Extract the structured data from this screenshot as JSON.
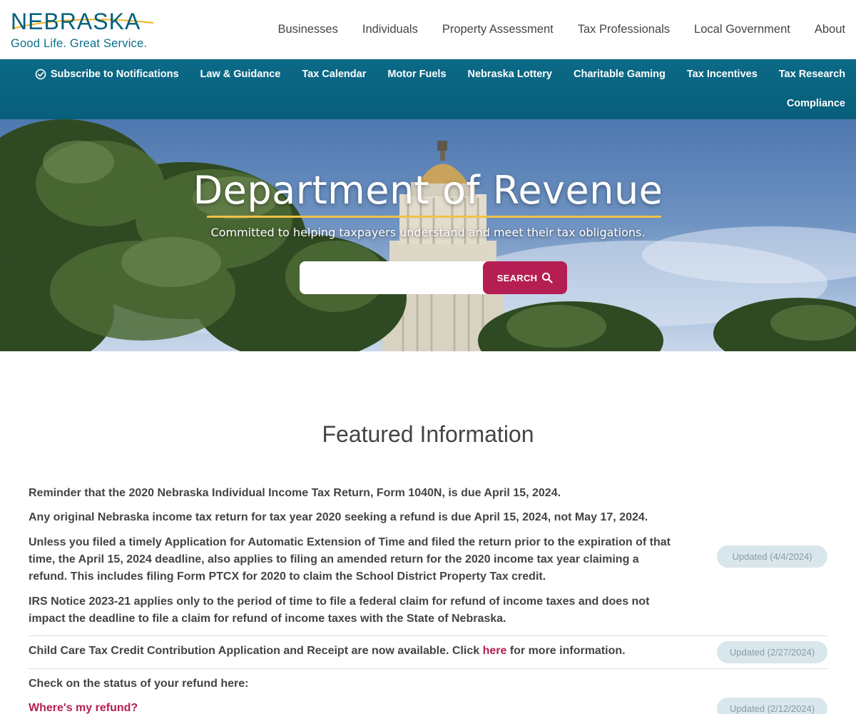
{
  "logo": {
    "wordmark": "NEBRASKA",
    "tagline": "Good Life. Great Service."
  },
  "main_nav": [
    {
      "label": "Businesses"
    },
    {
      "label": "Individuals"
    },
    {
      "label": "Property Assessment"
    },
    {
      "label": "Tax Professionals"
    },
    {
      "label": "Local Government"
    },
    {
      "label": "About"
    }
  ],
  "sub_nav": {
    "row1": [
      {
        "label": "Subscribe to Notifications",
        "icon": "check-circle-icon"
      },
      {
        "label": "Law & Guidance"
      },
      {
        "label": "Tax Calendar"
      },
      {
        "label": "Motor Fuels"
      },
      {
        "label": "Nebraska Lottery"
      },
      {
        "label": "Charitable Gaming"
      },
      {
        "label": "Tax Incentives"
      },
      {
        "label": "Tax Research"
      }
    ],
    "row2": [
      {
        "label": "Compliance"
      }
    ]
  },
  "hero": {
    "title": "Department of Revenue",
    "subtitle": "Committed to helping taxpayers understand and meet their tax obligations.",
    "search": {
      "placeholder": "",
      "value": "",
      "button_label": "SEARCH",
      "button_icon": "search-icon"
    }
  },
  "featured": {
    "heading": "Featured Information",
    "item1": {
      "p1": "Reminder that the 2020 Nebraska Individual Income Tax Return, Form 1040N, is due April 15, 2024.",
      "p2": "Any original Nebraska income tax return for tax year 2020 seeking a refund is due April 15, 2024, not May 17, 2024.",
      "p3": "Unless you filed a timely Application for Automatic Extension of Time and filed the return prior to the expiration of that time, the April 15, 2024 deadline, also applies to filing an amended return for the 2020 income tax year claiming a refund. This includes filing Form PTCX for 2020 to claim the School District Property Tax credit.",
      "p4": "IRS Notice 2023-21 applies only to the period of time to file a federal claim for refund of income taxes and does not impact the deadline to file a claim for refund of income taxes with the State of Nebraska.",
      "badge": "Updated (4/4/2024)"
    },
    "item2": {
      "text_before": "Child Care Tax Credit Contribution Application and Receipt are now available. Click ",
      "link": "here",
      "text_after": " for more information.",
      "badge": "Updated (2/27/2024)"
    },
    "item3": {
      "text": "Check on the status of your refund here:",
      "link": "Where's my refund?",
      "badge": "Updated (2/12/2024)"
    }
  },
  "colors": {
    "brand_teal": "#00607f",
    "accent_crimson": "#b51e52",
    "rule_gold": "#f0c246",
    "badge_bg": "#d9e6ec"
  }
}
